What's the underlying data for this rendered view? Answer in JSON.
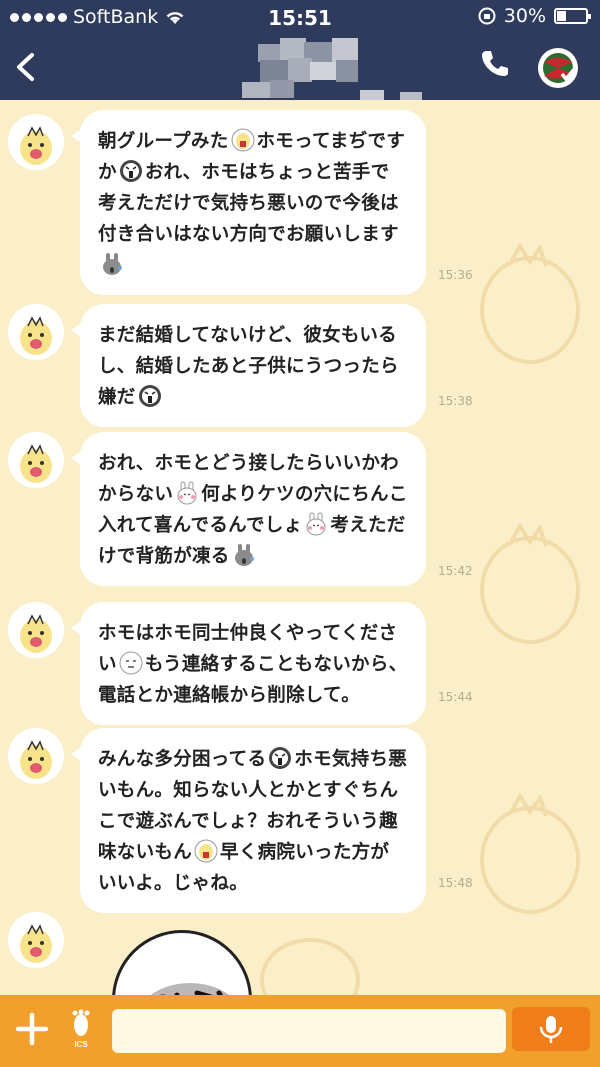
{
  "status_bar": {
    "carrier": "SoftBank",
    "time": "15:51",
    "battery": "30%",
    "battery_level": 0.3
  },
  "header": {
    "back_icon": "chevron-left-icon",
    "contact_name_hidden": true,
    "call_icon": "phone-icon",
    "profile_icon": "avatar-icon"
  },
  "messages": [
    {
      "text": [
        "朝グループみた",
        "{emo:scream-chick}",
        "ホモってまぢですか",
        "{emo:shock-face}",
        "おれ、ホモはちょっと苦手で考えただけで気持ち悪いので今後は付き合いはない方向でお願いします",
        "{emo:gray-rabbit}"
      ],
      "time": "15:36"
    },
    {
      "text": [
        "まだ結婚してないけど、彼女もいるし、結婚したあと子供にうつったら嫌だ",
        "{emo:shock-face}"
      ],
      "time": "15:38"
    },
    {
      "text": [
        "おれ、ホモとどう接したらいいかわからない",
        "{emo:pink-rabbit}",
        "何よりケツの穴にちんこ入れて喜んでるんでしょ",
        "{emo:pink-rabbit}",
        "考えただけで背筋が凍る",
        "{emo:gray-rabbit}"
      ],
      "time": "15:42"
    },
    {
      "text": [
        "ホモはホモ同士仲良くやってください",
        "{emo:plain-face}",
        "もう連絡することもないから、電話とか連絡帳から削除して。"
      ],
      "time": "15:44"
    },
    {
      "text": [
        "みんな多分困ってる",
        "{emo:shock-face}",
        "ホモ気持ち悪いもん。知らない人とかとすぐちんこで遊ぶんでしょ？おれそういう趣味ないもん",
        "{emo:scream-chick}",
        "早く病院いった方がいいよ。じゃね。"
      ],
      "time": "15:48"
    }
  ],
  "input_bar": {
    "add_icon": "plus-icon",
    "sticker_icon": "footprint-icon",
    "sticker_icon_label": "ICS",
    "message_value": "",
    "voice_icon": "microphone-icon"
  }
}
